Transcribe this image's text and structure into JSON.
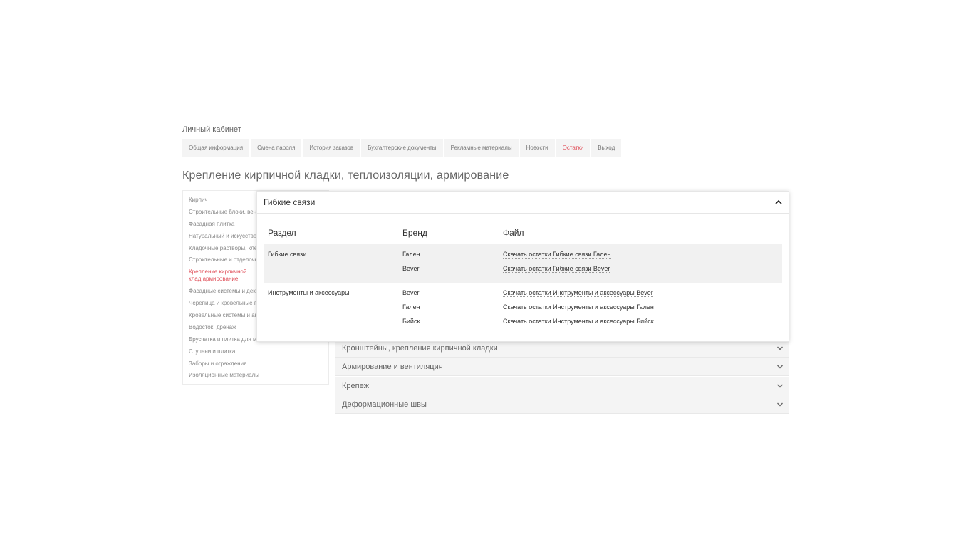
{
  "account": {
    "title": "Личный кабинет"
  },
  "tabs": [
    {
      "label": "Общая информация"
    },
    {
      "label": "Смена пароля"
    },
    {
      "label": "История заказов"
    },
    {
      "label": "Бухгалтерские документы"
    },
    {
      "label": "Рекламные материалы"
    },
    {
      "label": "Новости"
    },
    {
      "label": "Остатки",
      "active": true
    },
    {
      "label": "Выход"
    }
  ],
  "page_title": "Крепление кирпичной кладки, теплоизоляции, армирование",
  "sidebar": {
    "items": [
      {
        "label": "Кирпич"
      },
      {
        "label": "Строительные блоки, вент"
      },
      {
        "label": "Фасадная плитка"
      },
      {
        "label": "Натуральный и искусствен"
      },
      {
        "label": "Кладочные растворы, клеи"
      },
      {
        "label": "Строительные и отделочн"
      },
      {
        "label": "Крепление кирпичной клад армирование",
        "active": true
      },
      {
        "label": "Фасадные системы и деко"
      },
      {
        "label": "Черепица и кровельные п"
      },
      {
        "label": "Кровельные системы и ак"
      },
      {
        "label": "Водосток, дренаж"
      },
      {
        "label": "Брусчатка и плитка для мо"
      },
      {
        "label": "Ступени и плитка"
      },
      {
        "label": "Заборы и ограждения"
      },
      {
        "label": "Изоляционные материалы"
      }
    ]
  },
  "accordion": [
    {
      "label": "Кронштейны, крепления кирпичной кладки"
    },
    {
      "label": "Армирование и вентиляция"
    },
    {
      "label": "Крепеж"
    },
    {
      "label": "Деформационные швы"
    }
  ],
  "modal": {
    "title": "Гибкие связи",
    "columns": {
      "section": "Раздел",
      "brand": "Бренд",
      "file": "Файл"
    },
    "groups": [
      {
        "section": "Гибкие связи",
        "rows": [
          {
            "brand": "Гален",
            "file": "Скачать остатки Гибкие связи Гален"
          },
          {
            "brand": "Bever",
            "file": "Скачать остатки Гибкие связи Bever"
          }
        ]
      },
      {
        "section": "Инструменты и аксессуары",
        "rows": [
          {
            "brand": "Bever",
            "file": "Скачать остатки Инструменты и аксессуары Bever"
          },
          {
            "brand": "Гален",
            "file": "Скачать остатки Инструменты и аксессуары Гален"
          },
          {
            "brand": "Бийск",
            "file": "Скачать остатки Инструменты и аксессуары Бийск"
          }
        ]
      }
    ]
  },
  "icons": {
    "chevron_down": "chevron-down-icon",
    "chevron_up": "chevron-up-icon"
  },
  "colors": {
    "active": "#e0505a",
    "tab_bg": "#f4f4f4",
    "row_shade": "#f1f1f1"
  }
}
